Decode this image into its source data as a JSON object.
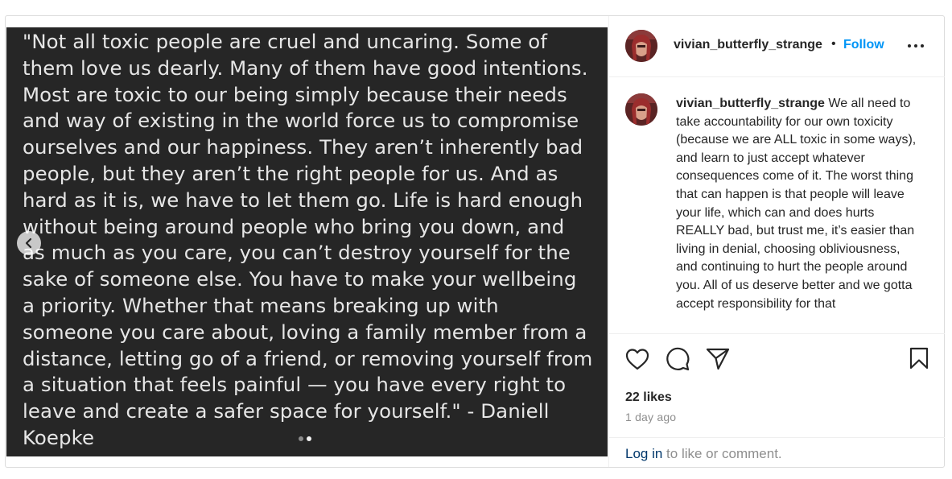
{
  "post": {
    "quote_text": "\"Not all toxic people are cruel and uncaring. Some of\nthem love us dearly. Many of them have good intentions.\nMost are toxic to our being simply because their needs\nand way of existing in the world force us to compromise\nourselves and our happiness. They aren’t inherently bad\npeople, but they aren’t the right people for us. And as\nhard as it is, we have to let them go. Life is hard enough\nwithout being around people who bring you down, and\nas much as you care, you can’t destroy yourself for the\nsake of someone else. You have to make your wellbeing\na priority. Whether that means breaking up with\nsomeone you care about, loving a family member from a\ndistance, letting go of a friend, or removing yourself from\na situation that feels painful — you have every right to\nleave and create a safer space for yourself.\" - Daniell\nKoepke",
    "carousel_total": 2,
    "carousel_active": 2
  },
  "header": {
    "username": "vivian_butterfly_strange",
    "separator": "•",
    "follow_label": "Follow"
  },
  "caption": {
    "username": "vivian_butterfly_strange",
    "text": " We all need to take accountability for our own toxicity (because we are ALL toxic in some ways), and learn to just accept whatever consequences come of it. The worst thing that can happen is that people will leave your life, which can and does hurts REALLY bad, but trust me, it’s easier than living in denial, choosing obliviousness, and continuing to hurt the people around you. All of us deserve better and we gotta accept responsibility for that"
  },
  "stats": {
    "likes": "22 likes",
    "time": "1 day ago"
  },
  "login": {
    "link": "Log in",
    "rest": " to like or comment."
  },
  "icons": {
    "prev": "chevron-left-icon",
    "more": "more-horizontal-icon",
    "like": "heart-icon",
    "comment": "comment-icon",
    "share": "share-icon",
    "save": "bookmark-icon"
  },
  "colors": {
    "accent": "#0095f6",
    "media_bg": "#262626",
    "link": "#00376b"
  }
}
